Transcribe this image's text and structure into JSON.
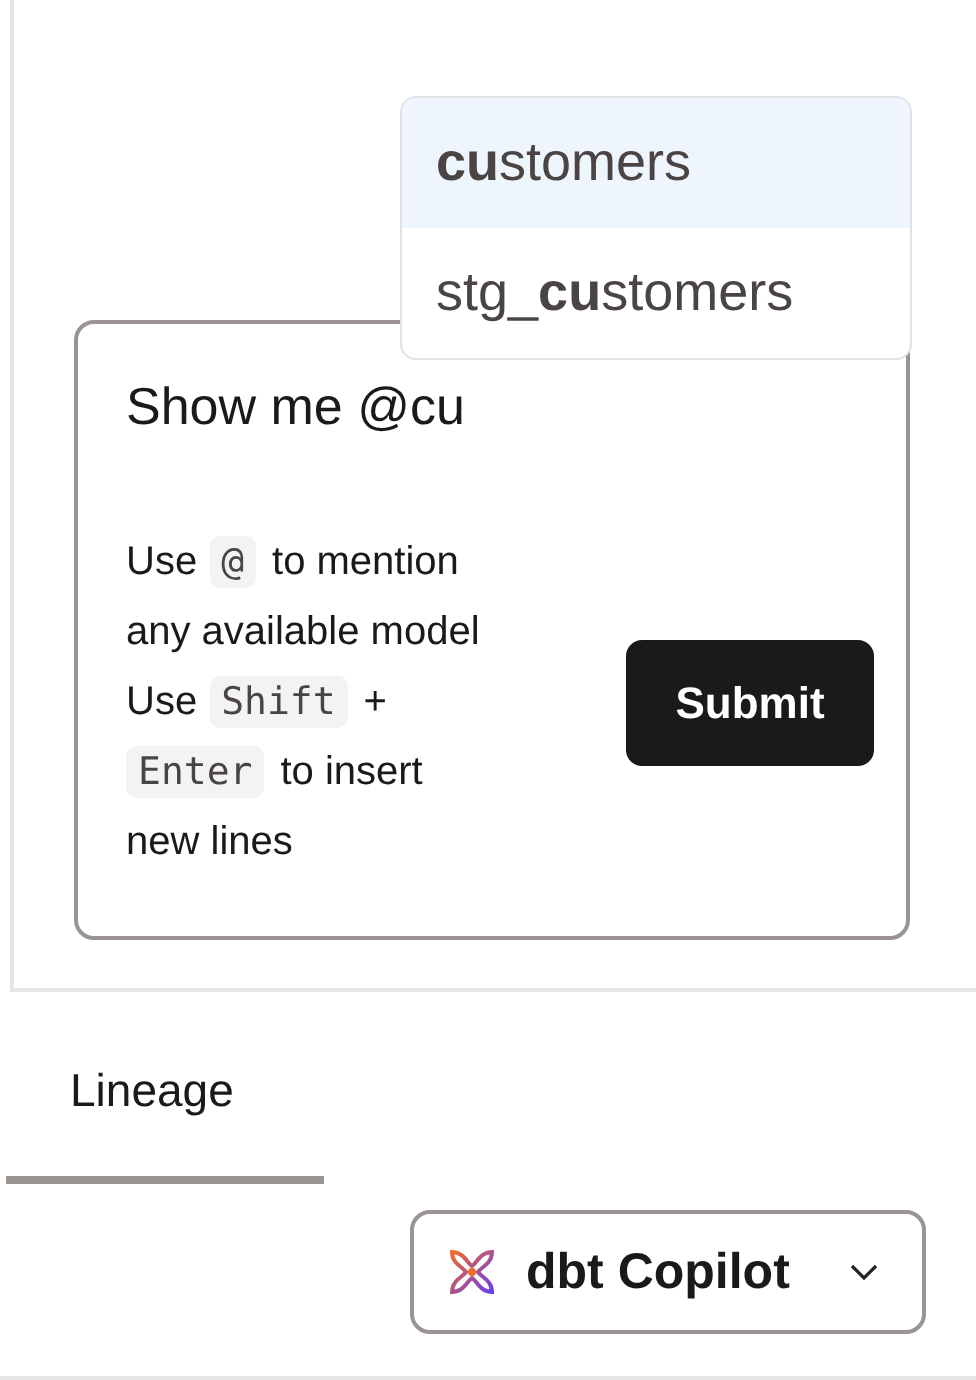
{
  "suggestions": [
    {
      "label": "**cu**stomers",
      "selected": true
    },
    {
      "label": "stg_**cu**stomers",
      "selected": false
    }
  ],
  "prompt": {
    "value": "Show me @cu"
  },
  "hint": [
    {
      "kind": "text",
      "text": "Use"
    },
    {
      "kind": "key",
      "text": "@"
    },
    {
      "kind": "text",
      "text": "to mention"
    },
    {
      "kind": "break"
    },
    {
      "kind": "text",
      "text": "any available model"
    },
    {
      "kind": "break"
    },
    {
      "kind": "text",
      "text": "Use"
    },
    {
      "kind": "key",
      "text": "Shift"
    },
    {
      "kind": "text",
      "text": "+"
    },
    {
      "kind": "break"
    },
    {
      "kind": "key",
      "text": "Enter"
    },
    {
      "kind": "text",
      "text": "to insert"
    },
    {
      "kind": "break"
    },
    {
      "kind": "text",
      "text": "new lines"
    }
  ],
  "submit": {
    "label": "Submit"
  },
  "tabs": [
    {
      "label": "Lineage",
      "selected": true
    }
  ],
  "assistant": {
    "label": "dbt Copilot"
  }
}
